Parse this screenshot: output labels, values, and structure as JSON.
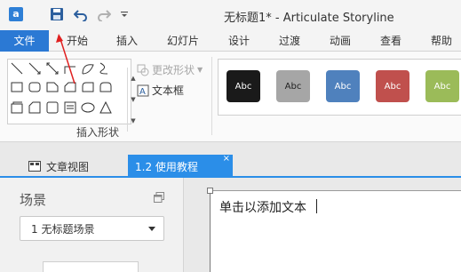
{
  "titlebar": {
    "title": "无标题1* - Articulate Storyline",
    "app_logo_glyph": "a",
    "quick_access": [
      "save-icon",
      "undo-icon",
      "redo-icon",
      "customize-icon"
    ]
  },
  "menu": {
    "items": [
      "文件",
      "开始",
      "插入",
      "幻灯片",
      "设计",
      "过渡",
      "动画",
      "查看",
      "帮助"
    ],
    "active": "文件",
    "accent": "#2b79d4"
  },
  "ribbon": {
    "shapes_group_label": "插入形状",
    "change_shape_label": "更改形状",
    "textbox_label": "文本框",
    "style_label": "Abc",
    "style_colors": [
      "#1a1a1a",
      "#a6a6a6",
      "#4f81bd",
      "#c0504d",
      "#9bbb59"
    ]
  },
  "tabs": {
    "document_view": "文章视图",
    "active_tab": "1.2 使用教程",
    "close_glyph": "×",
    "accent": "#2b8ee8"
  },
  "scene_panel": {
    "title": "场景",
    "selected_scene": "1 无标题场景"
  },
  "canvas": {
    "placeholder_text": "单击以添加文本"
  },
  "annotation": {
    "color": "#e02020"
  }
}
